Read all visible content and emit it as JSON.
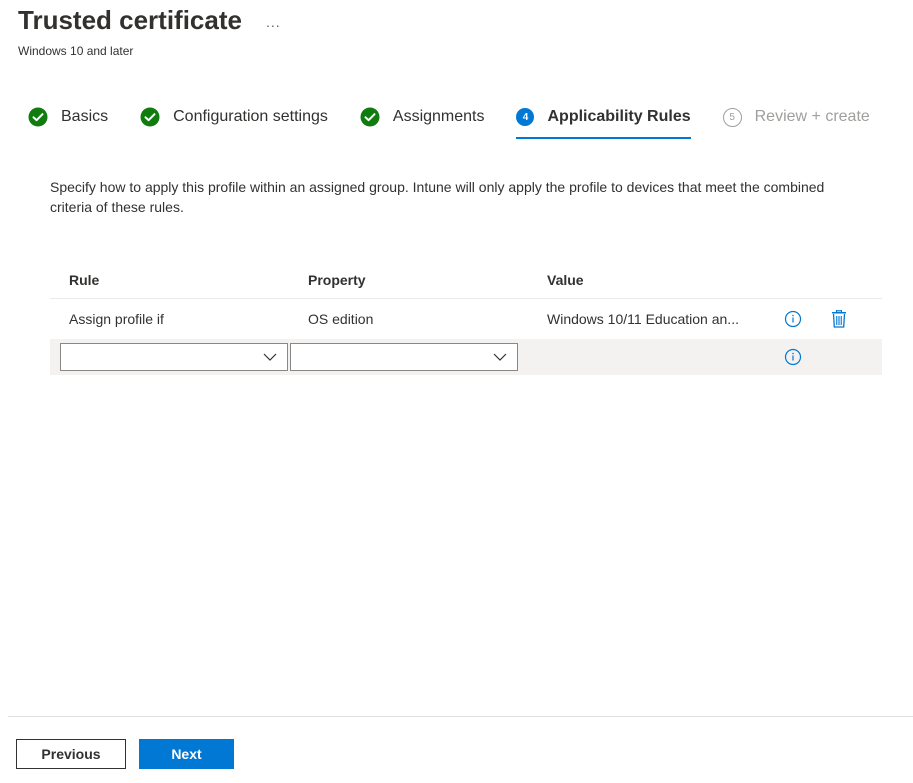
{
  "header": {
    "title": "Trusted certificate",
    "more_label": "...",
    "subtitle": "Windows 10 and later"
  },
  "steps": [
    {
      "label": "Basics",
      "state": "complete",
      "icon": "check-circle-icon"
    },
    {
      "label": "Configuration settings",
      "state": "complete",
      "icon": "check-circle-icon"
    },
    {
      "label": "Assignments",
      "state": "complete",
      "icon": "check-circle-icon"
    },
    {
      "label": "Applicability Rules",
      "state": "active",
      "number": "4"
    },
    {
      "label": "Review + create",
      "state": "disabled",
      "number": "5"
    }
  ],
  "description": "Specify how to apply this profile within an assigned group. Intune will only apply the profile to devices that meet the combined criteria of these rules.",
  "table": {
    "columns": [
      "Rule",
      "Property",
      "Value"
    ],
    "rows": [
      {
        "rule": "Assign profile if",
        "property": "OS edition",
        "value": "Windows 10/11 Education an..."
      }
    ],
    "new_row": {
      "rule_value": "",
      "property_value": ""
    }
  },
  "footer": {
    "previous_label": "Previous",
    "next_label": "Next"
  },
  "colors": {
    "accent": "#0078d4",
    "success": "#107c10",
    "disabled": "#a19f9d"
  }
}
